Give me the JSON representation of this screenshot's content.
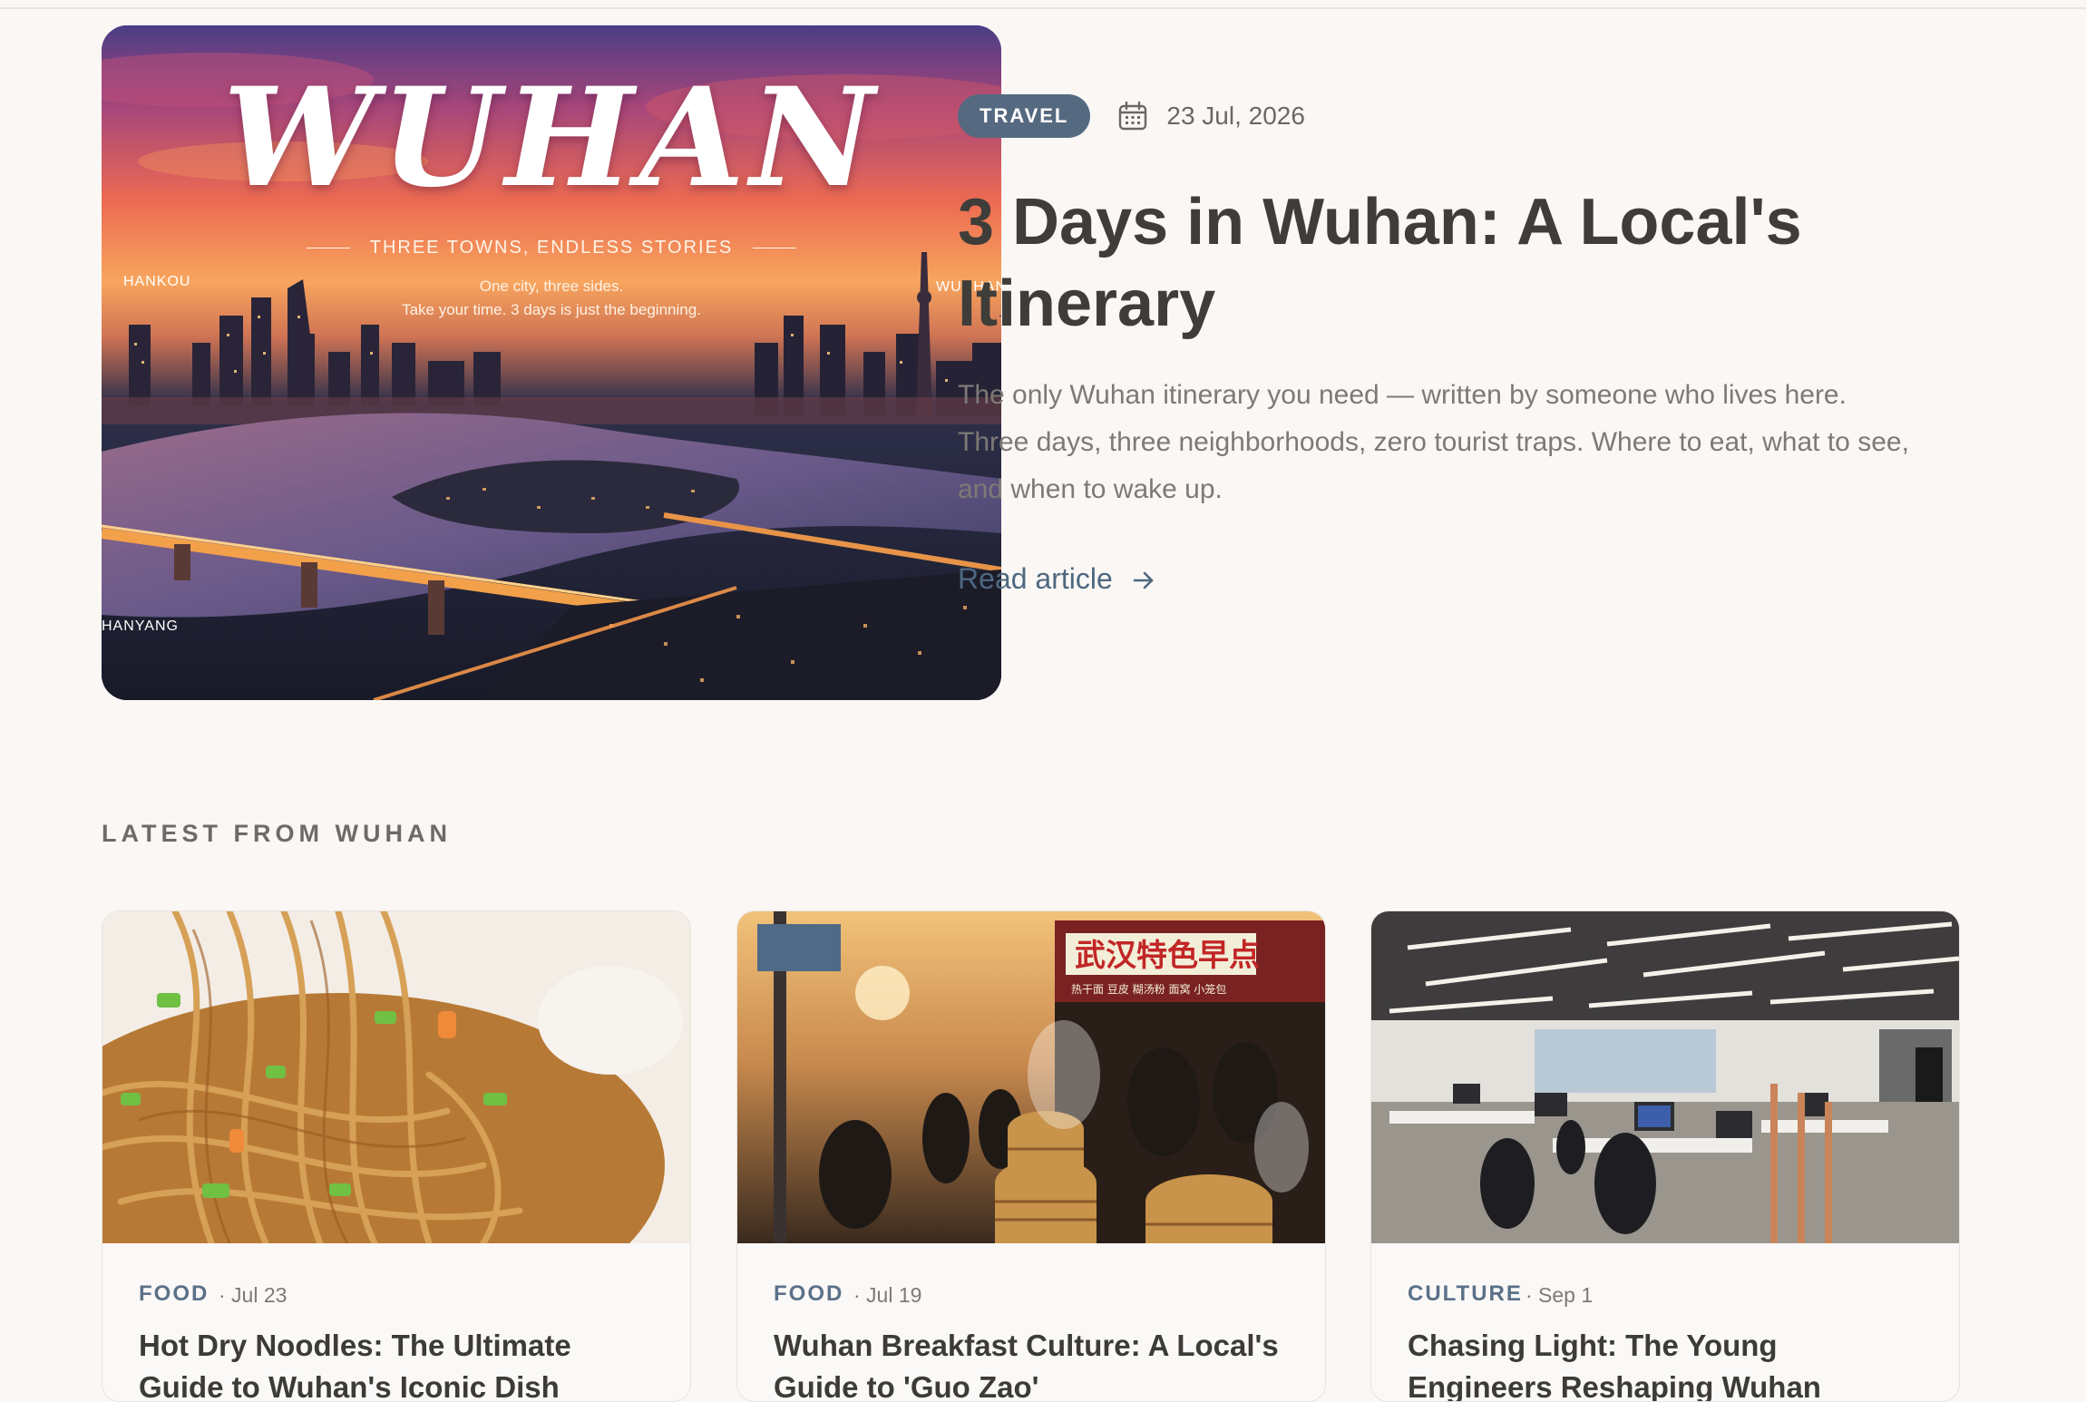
{
  "hero": {
    "image": {
      "title": "WUHAN",
      "subtitle": "THREE TOWNS, ENDLESS STORIES",
      "tagline_1": "One city, three sides.",
      "tagline_2": "Take your time. 3 days is just the beginning.",
      "district_1": "HANKOU",
      "district_2": "WUCHAN",
      "district_3": "HANYANG"
    },
    "category": "TRAVEL",
    "date_icon": "calendar-icon",
    "date": "23 Jul, 2026",
    "title": "3 Days in Wuhan: A Local's Itinerary",
    "excerpt": "The only Wuhan itinerary you need — written by someone who lives here. Three days, three neighborhoods, zero tourist traps. Where to eat, what to see, and when to wake up.",
    "read_label": "Read article",
    "read_icon": "arrow-right-icon"
  },
  "latest": {
    "heading": "LATEST FROM WUHAN",
    "cards": [
      {
        "category": "FOOD",
        "date": "· Jul 23",
        "title": "Hot Dry Noodles: The Ultimate",
        "title_line2": "Guide to Wuhan's Iconic Dish",
        "image": "noodles-photo"
      },
      {
        "category": "FOOD",
        "date": "· Jul 19",
        "title": "Wuhan Breakfast Culture: A Local's",
        "title_line2": "Guide to 'Guo Zao'",
        "image": "breakfast-street-photo",
        "sign_text": "武汉特色早点",
        "sign_sub": "热干面 豆皮 糊汤粉 面窝 小笼包"
      },
      {
        "category": "CULTURE",
        "date": "· Sep 1",
        "title": "Chasing Light: The Young",
        "title_line2": "Engineers Reshaping Wuhan",
        "image": "office-photo"
      }
    ]
  },
  "colors": {
    "page_bg": "#faf7f4",
    "badge_bg": "#556a80",
    "link": "#4e6880",
    "category": "#5b7188",
    "title": "#3f3d3a"
  }
}
